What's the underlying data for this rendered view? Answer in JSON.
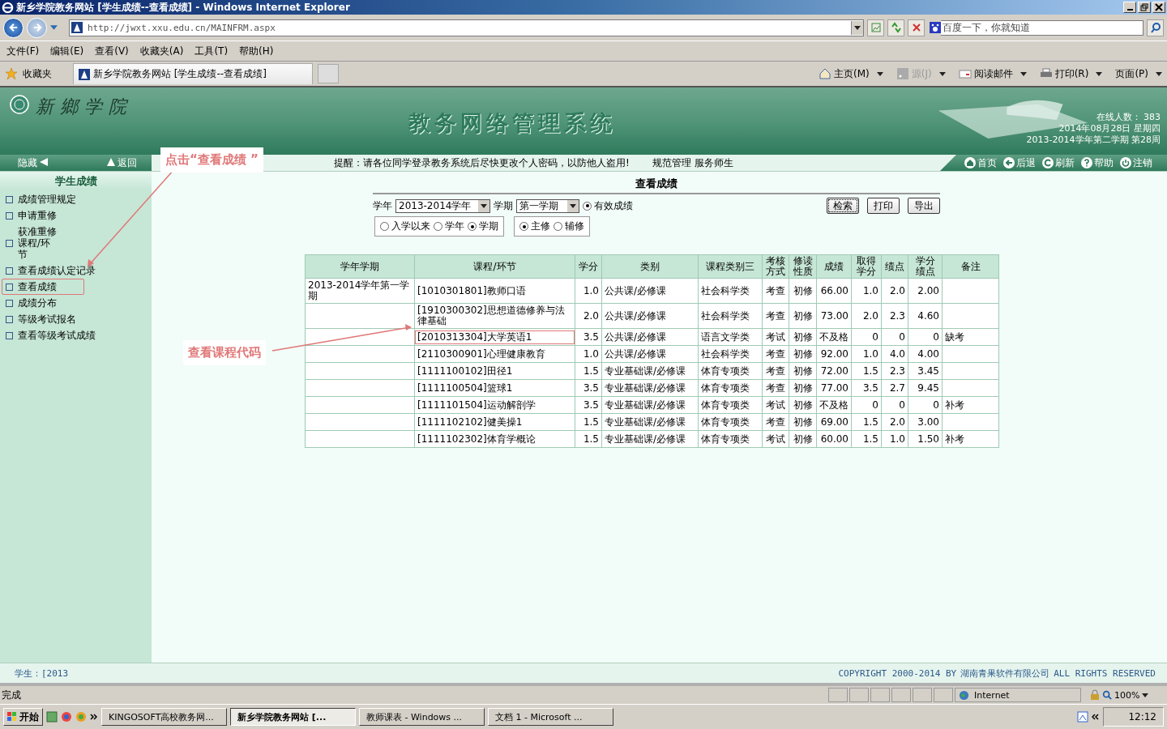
{
  "window": {
    "title": "新乡学院教务网站 [学生成绩--查看成绩] - Windows Internet Explorer"
  },
  "address": {
    "url": "http://jwxt.xxu.edu.cn/MAINFRM.aspx",
    "search_placeholder": "百度一下，你就知道"
  },
  "menu": [
    "文件(F)",
    "编辑(E)",
    "查看(V)",
    "收藏夹(A)",
    "工具(T)",
    "帮助(H)"
  ],
  "favorites": {
    "label": "收藏夹",
    "tab": "新乡学院教务网站 [学生成绩--查看成绩]"
  },
  "commands": [
    {
      "kind": "home",
      "label": "主页(M)",
      "disabled": false
    },
    {
      "kind": "feed",
      "label": "源(J)",
      "disabled": true
    },
    {
      "kind": "mail",
      "label": "阅读邮件",
      "disabled": false
    },
    {
      "kind": "print",
      "label": "打印(R)",
      "disabled": false
    },
    {
      "kind": "page",
      "label": "页面(P)",
      "disabled": false
    }
  ],
  "banner": {
    "logo": "新鄉学院",
    "title": "教务网络管理系统",
    "online_label": "在线人数：",
    "online_count": "383",
    "date": "2014年08月28日 星期四",
    "term": "2013-2014学年第二学期 第28周"
  },
  "nav": {
    "hide": "隐藏",
    "back": "返回",
    "notice": "提醒：请各位同学登录教务系统后尽快更改个人密码，以防他人盗用!",
    "slogan": "规范管理 服务师生",
    "links": [
      {
        "kind": "home",
        "label": "首页"
      },
      {
        "kind": "back",
        "label": "后退"
      },
      {
        "kind": "refresh",
        "label": "刷新"
      },
      {
        "kind": "help",
        "label": "帮助"
      },
      {
        "kind": "logout",
        "label": "注销"
      }
    ]
  },
  "sidebar": {
    "heading": "学生成绩",
    "items": [
      {
        "label": "成绩管理规定",
        "highlighted": false
      },
      {
        "label": "申请重修",
        "highlighted": false
      },
      {
        "label": "获准重修课程/环节",
        "highlighted": false
      },
      {
        "label": "查看成绩认定记录",
        "highlighted": false
      },
      {
        "label": "查看成绩",
        "highlighted": true
      },
      {
        "label": "成绩分布",
        "highlighted": false
      },
      {
        "label": "等级考试报名",
        "highlighted": false
      },
      {
        "label": "查看等级考试成绩",
        "highlighted": false
      }
    ]
  },
  "form": {
    "title": "查看成绩",
    "year_label": "学年",
    "year": "2013-2014学年",
    "term_label": "学期",
    "term": "第一学期",
    "valid": {
      "label": "有效成绩",
      "checked": true
    },
    "scope": [
      {
        "label": "入学以来",
        "selected": false
      },
      {
        "label": "学年",
        "selected": false
      },
      {
        "label": "学期",
        "selected": true
      }
    ],
    "major": [
      {
        "label": "主修",
        "selected": true
      },
      {
        "label": "辅修",
        "selected": false
      }
    ],
    "buttons": [
      "检索",
      "打印",
      "导出"
    ]
  },
  "table": {
    "columns": [
      "学年学期",
      "课程/环节",
      "学分",
      "类别",
      "课程类别三",
      "考核方式",
      "修读性质",
      "成绩",
      "取得学分",
      "绩点",
      "学分绩点",
      "备注"
    ],
    "rows": [
      {
        "term": "2013-2014学年第一学期",
        "course": "[1010301801]教师口语",
        "credit": "1.0",
        "category": "公共课/必修课",
        "category3": "社会科学类",
        "exam": "考查",
        "nature": "初修",
        "score": "66.00",
        "earned": "1.0",
        "gpa": "2.0",
        "credit_gpa": "2.00",
        "highlighted": false
      },
      {
        "course": "[1910300302]思想道德修养与法律基础",
        "credit": "2.0",
        "category": "公共课/必修课",
        "category3": "社会科学类",
        "exam": "考查",
        "nature": "初修",
        "score": "73.00",
        "earned": "2.0",
        "gpa": "2.3",
        "credit_gpa": "4.60",
        "highlighted": false
      },
      {
        "course": "[2010313304]大学英语1",
        "credit": "3.5",
        "category": "公共课/必修课",
        "category3": "语言文学类",
        "exam": "考试",
        "nature": "初修",
        "score": "不及格",
        "earned": "0",
        "gpa": "0",
        "credit_gpa": "0",
        "note": "缺考",
        "highlighted": true
      },
      {
        "course": "[2110300901]心理健康教育",
        "credit": "1.0",
        "category": "公共课/必修课",
        "category3": "社会科学类",
        "exam": "考查",
        "nature": "初修",
        "score": "92.00",
        "earned": "1.0",
        "gpa": "4.0",
        "credit_gpa": "4.00",
        "highlighted": false
      },
      {
        "course": "[1111100102]田径1",
        "credit": "1.5",
        "category": "专业基础课/必修课",
        "category3": "体育专项类",
        "exam": "考查",
        "nature": "初修",
        "score": "72.00",
        "earned": "1.5",
        "gpa": "2.3",
        "credit_gpa": "3.45",
        "highlighted": false
      },
      {
        "course": "[1111100504]篮球1",
        "credit": "3.5",
        "category": "专业基础课/必修课",
        "category3": "体育专项类",
        "exam": "考查",
        "nature": "初修",
        "score": "77.00",
        "earned": "3.5",
        "gpa": "2.7",
        "credit_gpa": "9.45",
        "highlighted": false
      },
      {
        "course": "[1111101504]运动解剖学",
        "credit": "3.5",
        "category": "专业基础课/必修课",
        "category3": "体育专项类",
        "exam": "考试",
        "nature": "初修",
        "score": "不及格",
        "earned": "0",
        "gpa": "0",
        "credit_gpa": "0",
        "note": "补考",
        "highlighted": false
      },
      {
        "course": "[1111102102]健美操1",
        "credit": "1.5",
        "category": "专业基础课/必修课",
        "category3": "体育专项类",
        "exam": "考查",
        "nature": "初修",
        "score": "69.00",
        "earned": "1.5",
        "gpa": "2.0",
        "credit_gpa": "3.00",
        "highlighted": false
      },
      {
        "course": "[1111102302]体育学概论",
        "credit": "1.5",
        "category": "专业基础课/必修课",
        "category3": "体育专项类",
        "exam": "考试",
        "nature": "初修",
        "score": "60.00",
        "earned": "1.5",
        "gpa": "1.0",
        "credit_gpa": "1.50",
        "note": "补考",
        "highlighted": false
      }
    ]
  },
  "annotations": [
    "点击“查看成绩 ”",
    "查看课程代码"
  ],
  "footer": {
    "student": "学生：[2013",
    "copyright": "COPYRIGHT 2000-2014 BY",
    "company": "湖南青果软件有限公司",
    "rights": "ALL RIGHTS RESERVED"
  },
  "status": {
    "text": "完成",
    "zone": "Internet",
    "zoom": "100%"
  },
  "taskbar": {
    "start": "开始",
    "tasks": [
      {
        "label": "KINGOSOFT高校教务网...",
        "selected": false
      },
      {
        "label": "新乡学院教务网站 [...",
        "selected": true
      },
      {
        "label": "教师课表 - Windows ...",
        "selected": false
      },
      {
        "label": "文档 1 - Microsoft ...",
        "selected": false
      }
    ],
    "clock": "12:12"
  }
}
